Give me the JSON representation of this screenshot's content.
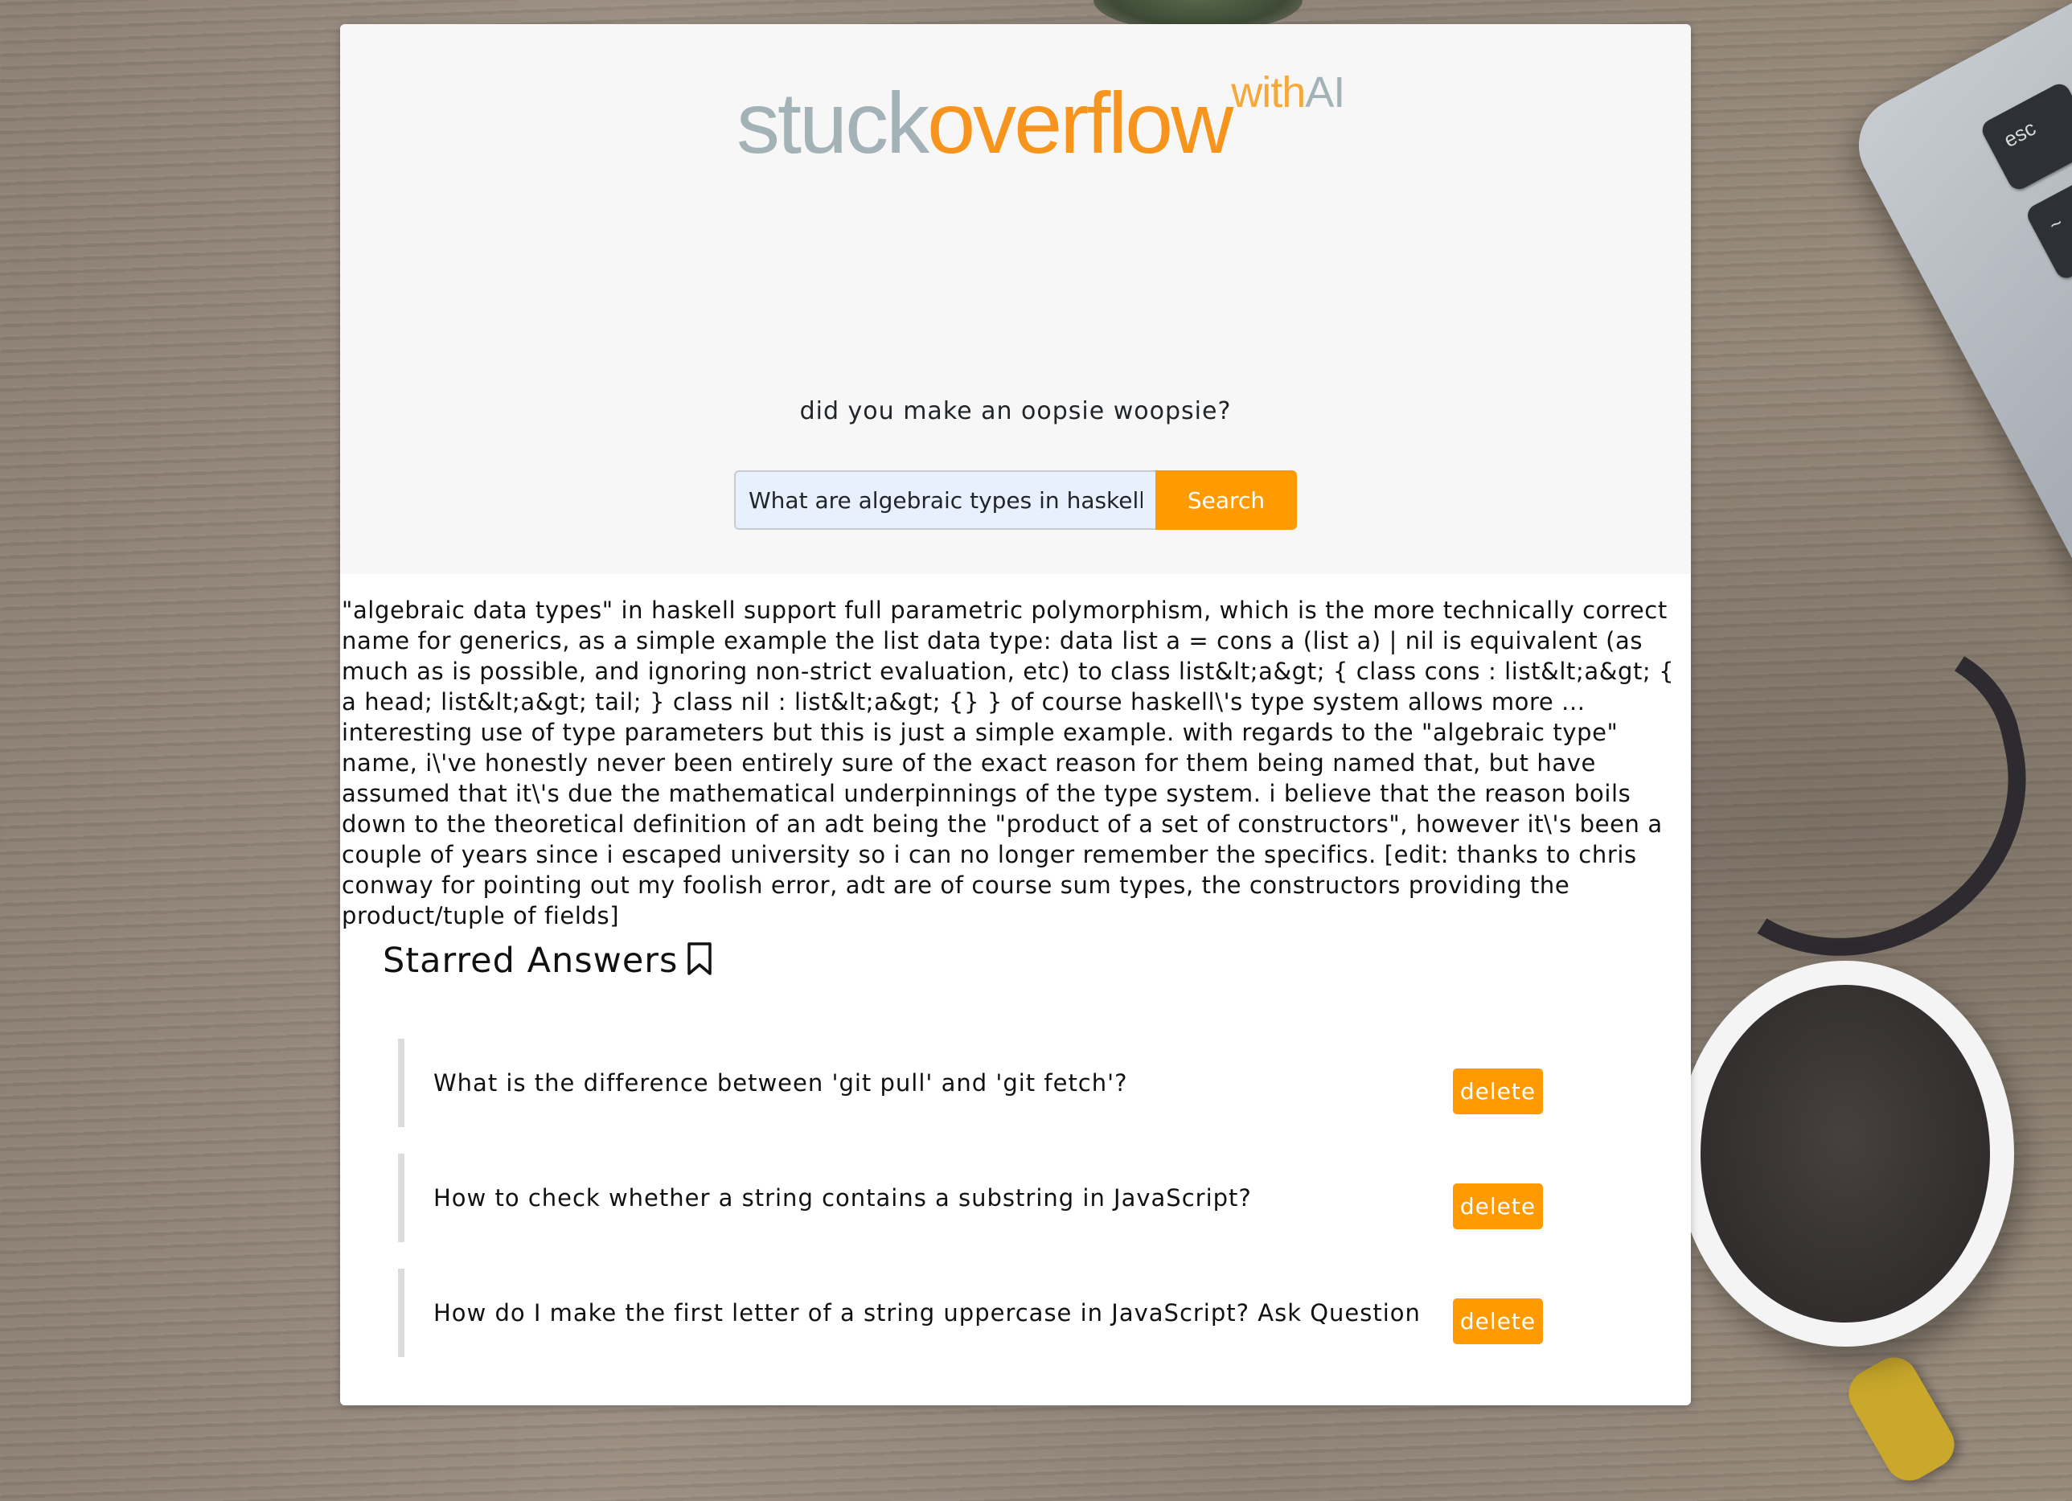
{
  "brand": {
    "logo_part1": "stuck",
    "logo_part2": "overflow",
    "logo_part3": "with",
    "logo_part4": "AI",
    "accent_color": "#ff9a00",
    "muted_color": "#a3b2b7"
  },
  "hero": {
    "tagline": "did you make an oopsie woopsie?"
  },
  "search": {
    "value": "What are algebraic types in haskell?",
    "button_label": "Search"
  },
  "answer": {
    "text": "\"algebraic data types\" in haskell support full parametric polymorphism, which is the more technically correct name for generics, as a simple example the list data type: data list a = cons a (list a) | nil is equivalent (as much as is possible, and ignoring non-strict evaluation, etc) to class list&lt;a&gt; { class cons : list&lt;a&gt; { a head; list&lt;a&gt; tail; } class nil : list&lt;a&gt; {} } of course haskell\\'s type system allows more ... interesting use of type parameters but this is just a simple example. with regards to the \"algebraic type\" name, i\\'ve honestly never been entirely sure of the exact reason for them being named that, but have assumed that it\\'s due the mathematical underpinnings of the type system. i believe that the reason boils down to the theoretical definition of an adt being the \"product of a set of constructors\", however it\\'s been a couple of years since i escaped university so i can no longer remember the specifics. [edit: thanks to chris conway for pointing out my foolish error, adt are of course sum types, the constructors providing the product/tuple of fields]"
  },
  "starred": {
    "title": "Starred Answers",
    "icon": "bookmark-icon",
    "items": [
      {
        "question": "What is the difference between 'git pull' and 'git fetch'?",
        "delete_label": "delete"
      },
      {
        "question": "How to check whether a string contains a substring in JavaScript?",
        "delete_label": "delete"
      },
      {
        "question": "How do I make the first letter of a string uppercase in JavaScript? Ask Question",
        "delete_label": "delete"
      }
    ]
  }
}
